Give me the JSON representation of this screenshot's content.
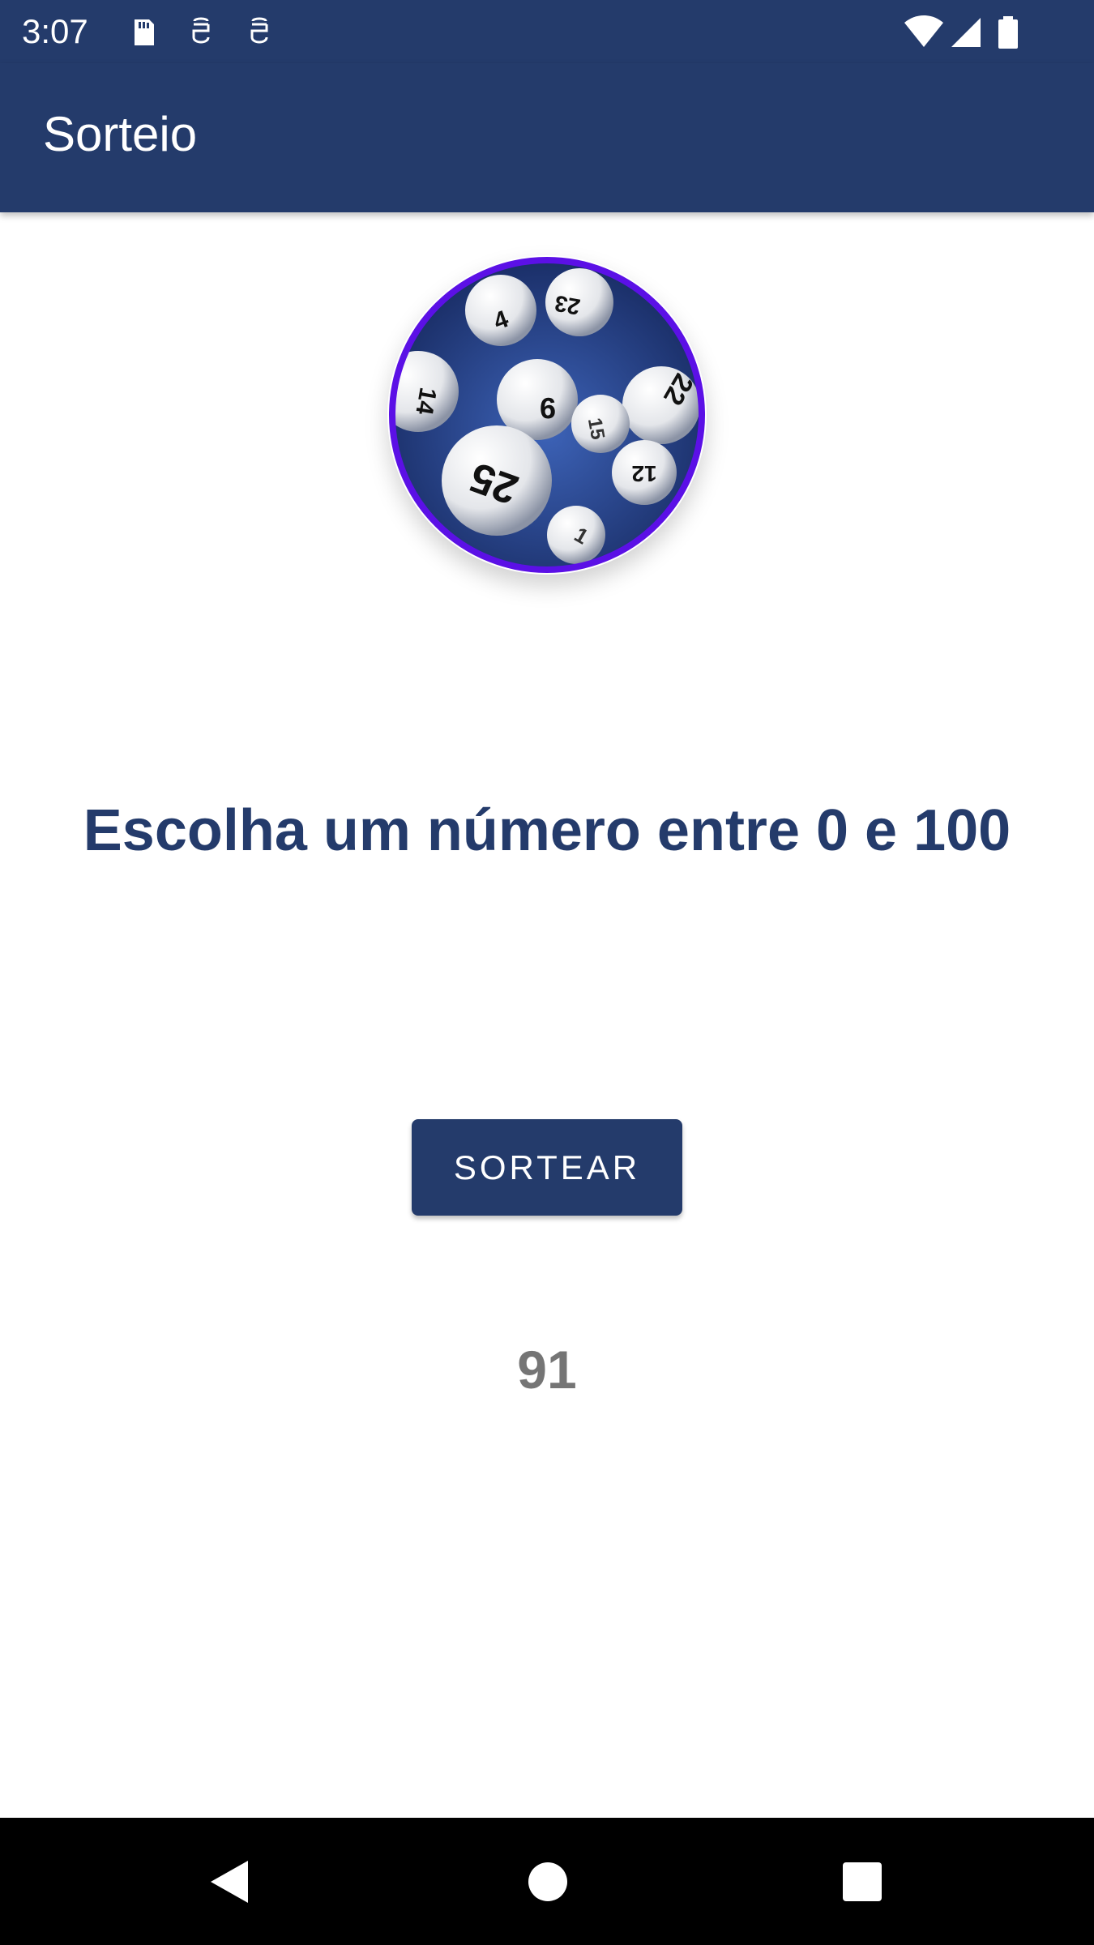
{
  "status_bar": {
    "time": "3:07",
    "left_icons": [
      "sd-card-icon",
      "app-notification-icon",
      "app-notification-icon"
    ],
    "right_icons": [
      "wifi-icon",
      "cell-signal-icon",
      "battery-icon"
    ]
  },
  "app_bar": {
    "title": "Sorteio"
  },
  "avatar": {
    "description_icon": "lottery-balls-image",
    "ring_color": "#5b10e6",
    "ball_numbers": [
      "4",
      "23",
      "22",
      "9",
      "14",
      "15",
      "25",
      "12",
      "1"
    ]
  },
  "main": {
    "headline": "Escolha um número entre 0 e 100",
    "button_label": "SORTEAR",
    "result": "91"
  },
  "nav_bar": {
    "buttons": [
      "back-icon",
      "home-icon",
      "recents-icon"
    ]
  },
  "colors": {
    "primary": "#243b6b",
    "result_text": "#757575",
    "avatar_ring": "#5b10e6"
  }
}
